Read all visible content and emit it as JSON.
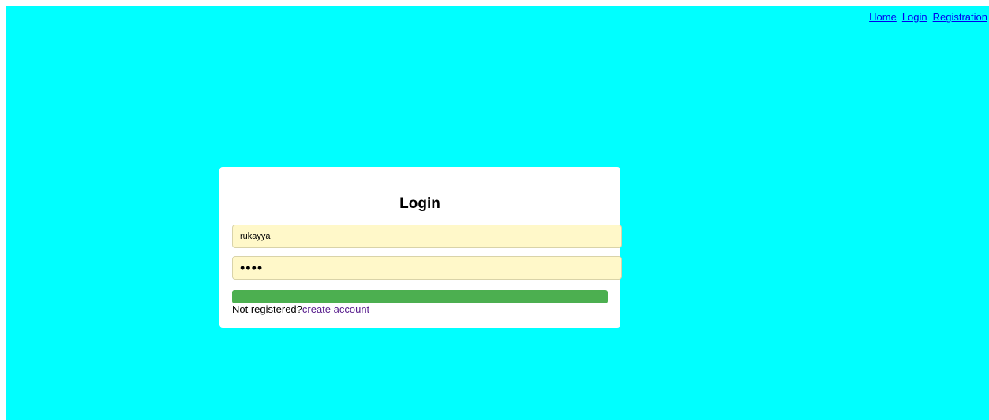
{
  "nav": {
    "home": "Home",
    "login": "Login",
    "registration": "Registration"
  },
  "login_form": {
    "title": "Login",
    "username_value": "rukayya",
    "password_value": "••••",
    "submit_label": "",
    "register_prompt": "Not registered?",
    "register_link": "create account"
  },
  "colors": {
    "page_background": "#00ffff",
    "card_background": "#ffffff",
    "input_background": "#fff8c9",
    "button_green": "#4caf50",
    "link_blue": "#0000ee",
    "link_visited": "#551a8b"
  }
}
